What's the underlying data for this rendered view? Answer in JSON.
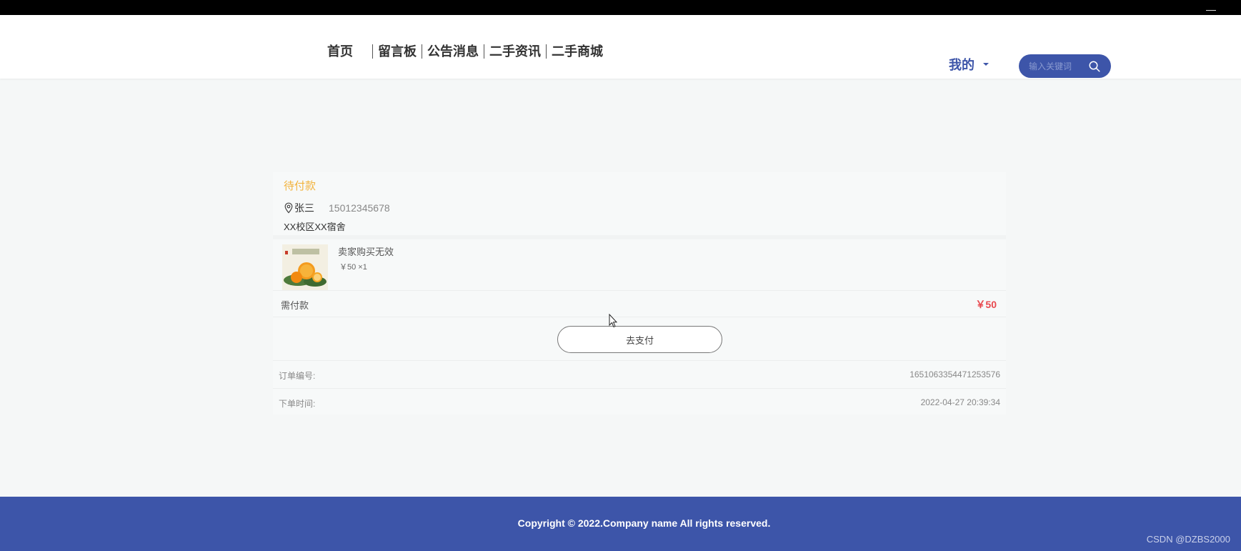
{
  "nav": {
    "items": [
      "首页",
      "留言板",
      "公告消息",
      "二手资讯",
      "二手商城"
    ]
  },
  "user_menu": {
    "label": "我的"
  },
  "search": {
    "placeholder": "输入关键词"
  },
  "order": {
    "status": "待付款",
    "receiver": "张三",
    "phone": "15012345678",
    "address": "XX校区XX宿舍",
    "product": {
      "name": "卖家购买无效",
      "price_qty": "￥50 ×1"
    },
    "due_label": "需付款",
    "due_amount": "￥50",
    "pay_button": "去支付",
    "order_no_label": "订单编号:",
    "order_no": "1651063354471253576",
    "time_label": "下单时间:",
    "time": "2022-04-27 20:39:34"
  },
  "footer": {
    "copyright": "Copyright © 2022.Company name All rights reserved.",
    "watermark": "CSDN @DZBS2000"
  },
  "colors": {
    "brand": "#3d55a9",
    "status": "#f2b33d",
    "price": "#e8494f"
  }
}
